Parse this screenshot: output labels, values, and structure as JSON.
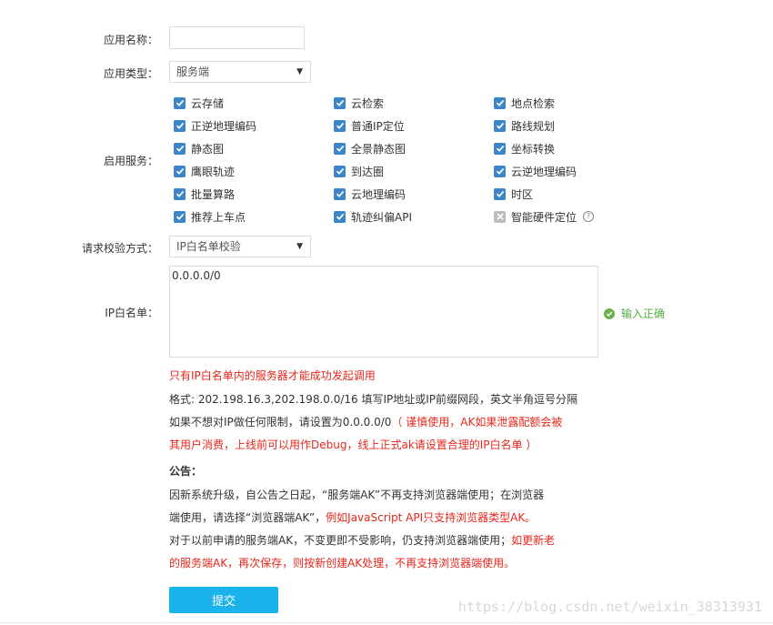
{
  "form": {
    "app_name_label": "应用名称：",
    "app_name_value": "",
    "app_type_label": "应用类型：",
    "app_type_value": "服务端",
    "services_label": "启用服务：",
    "verify_label": "请求校验方式：",
    "verify_value": "IP白名单校验",
    "ip_label": "IP白名单：",
    "ip_value": "0.0.0.0/0",
    "ip_status": "输入正确"
  },
  "services": [
    {
      "label": "云存储",
      "checked": true
    },
    {
      "label": "云检索",
      "checked": true
    },
    {
      "label": "地点检索",
      "checked": true
    },
    {
      "label": "正逆地理编码",
      "checked": true
    },
    {
      "label": "普通IP定位",
      "checked": true
    },
    {
      "label": "路线规划",
      "checked": true
    },
    {
      "label": "静态图",
      "checked": true
    },
    {
      "label": "全景静态图",
      "checked": true
    },
    {
      "label": "坐标转换",
      "checked": true
    },
    {
      "label": "鹰眼轨迹",
      "checked": true
    },
    {
      "label": "到达圈",
      "checked": true
    },
    {
      "label": "云逆地理编码",
      "checked": true
    },
    {
      "label": "批量算路",
      "checked": true
    },
    {
      "label": "云地理编码",
      "checked": true
    },
    {
      "label": "时区",
      "checked": true
    },
    {
      "label": "推荐上车点",
      "checked": true
    },
    {
      "label": "轨迹纠偏API",
      "checked": true
    },
    {
      "label": "智能硬件定位",
      "checked": false,
      "help": "?"
    }
  ],
  "notes": {
    "warning": "只有IP白名单内的服务器才能成功发起调用",
    "format": "格式: 202.198.16.3,202.198.0.0/16 填写IP地址或IP前缀网段，英文半角逗号分隔",
    "no_limit": "如果不想对IP做任何限制，请设置为0.0.0.0/0",
    "caution_1": "（ 谨慎使用，AK如果泄露配额会被",
    "caution_2": "其用户消费，上线前可以用作Debug，线上正式ak请设置合理的IP白名单 ）"
  },
  "notice": {
    "title": "公告：",
    "line1": "因新系统升级，自公告之日起，“服务端AK”不再支持浏览器端使用；在浏览器",
    "line2_a": "端使用，请选择“浏览器端AK”，",
    "line2_b": "例如JavaScript API只支持浏览器类型AK。",
    "line3_a": "对于以前申请的服务端AK，不变更即不受影响，仍支持浏览器端使用；",
    "line3_b": "如更新老",
    "line4": "的服务端AK，再次保存，则按新创建AK处理，不再支持浏览器端使用。"
  },
  "submit_label": "提交",
  "watermark": "https://blog.csdn.net/weixin_38313931",
  "colors": {
    "checkbox": "#3a86c8",
    "button": "#1ab3ec",
    "warning": "#e8261c",
    "ok": "#58a847"
  }
}
